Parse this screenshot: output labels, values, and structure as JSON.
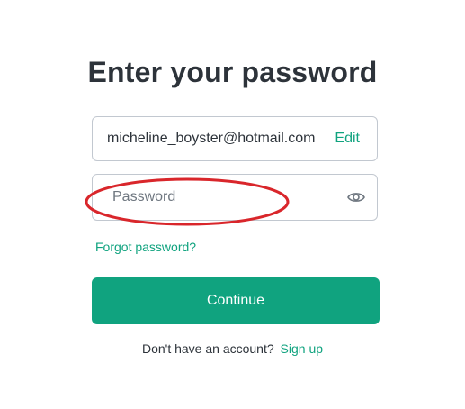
{
  "header": {
    "title": "Enter your password"
  },
  "email": {
    "value": "micheline_boyster@hotmail.com",
    "edit_label": "Edit"
  },
  "password": {
    "placeholder": "Password",
    "value": "",
    "toggle_icon": "eye-icon"
  },
  "forgot": {
    "label": "Forgot password?"
  },
  "continue": {
    "label": "Continue"
  },
  "signup": {
    "prompt": "Don't have an account?",
    "link_label": "Sign up"
  },
  "colors": {
    "accent": "#10a37f",
    "text": "#2d333a",
    "border": "#c2c8d0",
    "annotation": "#d9262b"
  }
}
